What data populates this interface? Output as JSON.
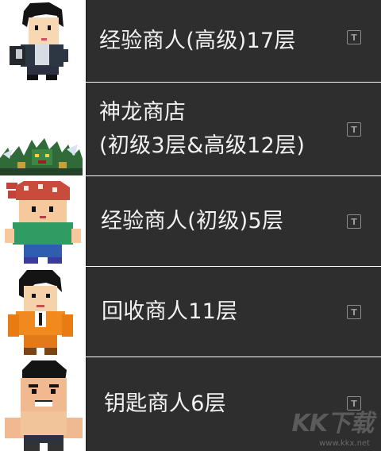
{
  "items": [
    {
      "label": "经验商人(高级)17层",
      "portrait": "pixel-merchant-man-icon",
      "action_icon": "text-t-icon"
    },
    {
      "label": "神龙商店\n(初级3层&高级12层)",
      "portrait": "pixel-green-dragon-icon",
      "action_icon": "text-t-icon"
    },
    {
      "label": "经验商人(初级)5层",
      "portrait": "pixel-bandana-boy-icon",
      "action_icon": "text-t-icon"
    },
    {
      "label": "回收商人11层",
      "portrait": "pixel-orange-suit-man-icon",
      "action_icon": "text-t-icon"
    },
    {
      "label": "钥匙商人6层",
      "portrait": "pixel-muscle-man-icon",
      "action_icon": "text-t-icon"
    }
  ],
  "action_glyph": "T",
  "watermark": {
    "logo": "KK下载",
    "url": "www.kkx.net"
  },
  "colors": {
    "row_bg": "#2e2e2e",
    "text": "#f2f2f2",
    "portrait_bg": "#ffffff"
  }
}
